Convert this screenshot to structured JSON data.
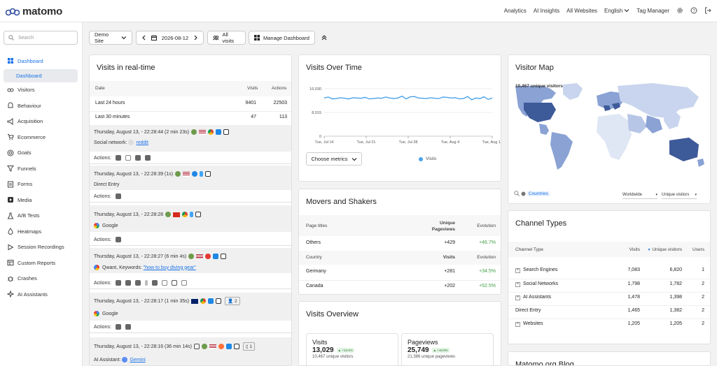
{
  "app": {
    "name": "matomo"
  },
  "topnav": {
    "analytics": "Analytics",
    "ai_insights": "AI Insights",
    "all_websites": "All Websites",
    "language": "English",
    "tag_manager": "Tag Manager"
  },
  "sidebar": {
    "search_placeholder": "Search",
    "items": [
      {
        "label": "Dashboard",
        "icon": "dashboard-icon"
      },
      {
        "label": "Visitors",
        "icon": "visitors-icon"
      },
      {
        "label": "Behaviour",
        "icon": "behaviour-icon"
      },
      {
        "label": "Acquisition",
        "icon": "acquisition-icon"
      },
      {
        "label": "Ecommerce",
        "icon": "ecommerce-icon"
      },
      {
        "label": "Goals",
        "icon": "goals-icon"
      },
      {
        "label": "Funnels",
        "icon": "funnels-icon"
      },
      {
        "label": "Forms",
        "icon": "forms-icon"
      },
      {
        "label": "Media",
        "icon": "media-icon"
      },
      {
        "label": "A/B Tests",
        "icon": "ab-tests-icon"
      },
      {
        "label": "Heatmaps",
        "icon": "heatmaps-icon"
      },
      {
        "label": "Session Recordings",
        "icon": "session-recordings-icon"
      },
      {
        "label": "Custom Reports",
        "icon": "custom-reports-icon"
      },
      {
        "label": "Crashes",
        "icon": "crashes-icon"
      },
      {
        "label": "AI Assistants",
        "icon": "ai-assistants-icon"
      }
    ],
    "sub_item": "Dashboard"
  },
  "controls": {
    "site": "Demo Site",
    "date": "2026-08-12",
    "segment": "All visits",
    "manage": "Manage Dashboard"
  },
  "realtime": {
    "title": "Visits in real-time",
    "headers": {
      "date": "Date",
      "visits": "Visits",
      "actions": "Actions"
    },
    "rows": [
      {
        "label": "Last 24 hours",
        "visits": "9401",
        "actions": "22503"
      },
      {
        "label": "Last 30 minutes",
        "visits": "47",
        "actions": "113"
      }
    ],
    "visits": [
      {
        "time": "Thursday, August 13, - 22:28:44 (2 min 23s)",
        "source_label": "Social network:",
        "source_link": "reddit",
        "actions": "Actions:"
      },
      {
        "time": "Thursday, August 13, - 22:28:39 (1s)",
        "source_label": "Direct Entry",
        "source_link": "",
        "actions": "Actions:"
      },
      {
        "time": "Thursday, August 13, - 22:28:28",
        "source_label": "Google",
        "source_link": "",
        "actions": "Actions:"
      },
      {
        "time": "Thursday, August 13, - 22:28:27 (6 min 4s)",
        "source_label": "Qwant, Keywords:",
        "source_link": "\"how to buy diving gear\"",
        "actions": "Actions:"
      },
      {
        "time": "Thursday, August 13, - 22:28:17 (1 min 35s)",
        "source_label": "Google",
        "source_link": "",
        "actions": "Actions:",
        "count": "2"
      },
      {
        "time": "Thursday, August 13, - 22:28:16 (36 min 14s)",
        "source_label": "AI Assistant:",
        "source_link": "Gemini",
        "actions": "",
        "count": "1"
      }
    ]
  },
  "visits_over_time": {
    "title": "Visits Over Time",
    "choose_metrics": "Choose metrics",
    "legend": "Visits"
  },
  "chart_data": {
    "type": "line",
    "title": "Visits Over Time",
    "series": [
      {
        "name": "Visits",
        "values": [
          12900,
          13200,
          12600,
          12700,
          13000,
          12800,
          12600,
          13000,
          12900,
          12800,
          13100,
          12600,
          12700,
          12900,
          12800,
          13200,
          12900,
          12700,
          12900,
          13500,
          12600,
          13300,
          13400,
          12900,
          12800,
          12700,
          13000,
          12800,
          12700,
          13200,
          13100,
          12900,
          13000,
          12600,
          12700,
          13400,
          12300,
          12900,
          12700,
          13300,
          12400,
          12900
        ]
      }
    ],
    "x_ticks": [
      "Tue, Jul 14",
      "Tue, Jul 21",
      "Tue, Jul 28",
      "Tue, Aug 4",
      "Tue, Aug 11"
    ],
    "y_ticks": [
      "0",
      "8,015",
      "16,030"
    ],
    "ylim": [
      0,
      16030
    ]
  },
  "visitor_map": {
    "title": "Visitor Map",
    "summary": "10,467 unique visitors",
    "countries": "Countries",
    "region": "Worldwide",
    "metric": "Unique visitors"
  },
  "movers": {
    "title": "Movers and Shakers",
    "page_headers": {
      "label": "Page titles",
      "pv": "Unique Pageviews",
      "evo": "Evolution"
    },
    "pages": [
      {
        "label": "Others",
        "value": "+429",
        "evo": "+46.7%"
      }
    ],
    "country_headers": {
      "label": "Country",
      "visits": "Visits",
      "evo": "Evolution"
    },
    "countries": [
      {
        "label": "Germany",
        "value": "+281",
        "evo": "+34.5%"
      },
      {
        "label": "Canada",
        "value": "+202",
        "evo": "+52.5%"
      }
    ]
  },
  "overview": {
    "title": "Visits Overview",
    "cards": [
      {
        "label": "Visits",
        "value": "13,029",
        "delta": "▲ +13.4%",
        "sub": "10,467 unique visitors"
      },
      {
        "label": "Pageviews",
        "value": "25,749",
        "delta": "▲ +15.9%",
        "sub": "21,386 unique pageviews"
      }
    ]
  },
  "channels": {
    "title": "Channel Types",
    "headers": {
      "type": "Channel Type",
      "visits": "Visits",
      "unique": "Unique visitors",
      "users": "Users"
    },
    "rows": [
      {
        "label": "Search Engines",
        "visits": "7,083",
        "unique": "6,820",
        "users": "1",
        "expand": true
      },
      {
        "label": "Social Networks",
        "visits": "1,798",
        "unique": "1,782",
        "users": "2",
        "expand": true
      },
      {
        "label": "AI Assistants",
        "visits": "1,478",
        "unique": "1,398",
        "users": "2",
        "expand": true
      },
      {
        "label": "Direct Entry",
        "visits": "1,465",
        "unique": "1,382",
        "users": "2",
        "expand": false
      },
      {
        "label": "Websites",
        "visits": "1,205",
        "unique": "1,205",
        "users": "2",
        "expand": true
      }
    ]
  },
  "blog": {
    "title": "Matomo.org Blog"
  },
  "colors": {
    "accent": "#1a73e8",
    "green": "#43a047",
    "line": "#4aa3ea",
    "map_dark": "#3d5a99",
    "map_mid": "#8aa2d4",
    "map_light": "#c9d5ee"
  }
}
